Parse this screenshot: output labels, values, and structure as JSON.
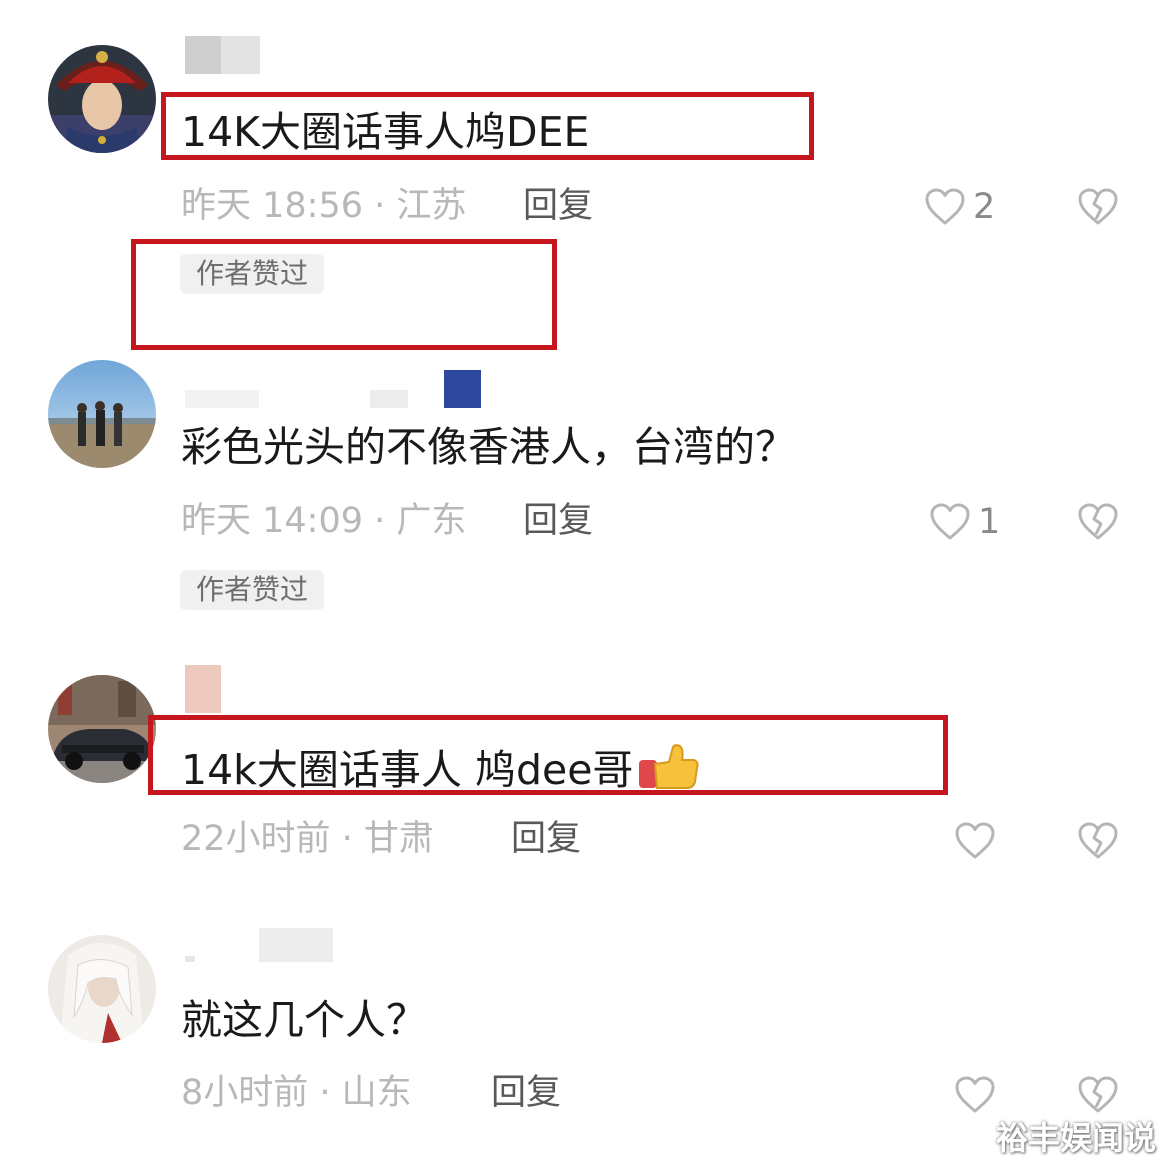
{
  "comments": [
    {
      "text": "14K大圈话事人鸠DEE",
      "meta": "昨天 18:56 · 江苏",
      "reply_label": "回复",
      "like_count": "2",
      "badge": "作者赞过",
      "avatar_icon": "avatar-qing-official-hat",
      "highlighted": true
    },
    {
      "text": "彩色光头的不像香港人，台湾的？",
      "meta": "昨天 14:09 · 广东",
      "reply_label": "回复",
      "like_count": "1",
      "badge": "作者赞过",
      "avatar_icon": "avatar-desert-group-photo",
      "highlighted": false
    },
    {
      "text": "14k大圈话事人 鸠dee哥",
      "meta": "22小时前 · 甘肃",
      "reply_label": "回复",
      "like_count": "",
      "avatar_icon": "avatar-black-car",
      "emoji": "thumbs-up",
      "highlighted": true
    },
    {
      "text": "就这几个人？",
      "meta": "8小时前 · 山东",
      "reply_label": "回复",
      "like_count": "",
      "avatar_icon": "avatar-white-hair-character",
      "highlighted": false
    }
  ],
  "icons": {
    "like": "heart-outline-icon",
    "dislike": "broken-heart-icon"
  },
  "colors": {
    "highlight_box": "#c4161c",
    "meta_text": "#b8b8b8",
    "badge_bg": "#f0f0f0"
  },
  "watermark": "裕丰娱闻说"
}
